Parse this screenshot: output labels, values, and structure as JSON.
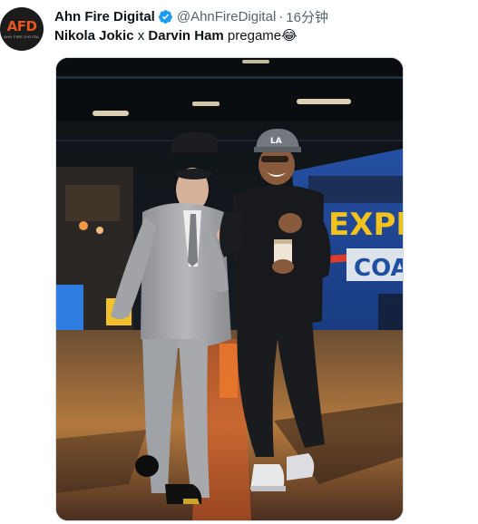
{
  "author": {
    "display_name": "Ahn Fire Digital",
    "handle": "@AhnFireDigital",
    "separator": "·",
    "timestamp": "16分钟",
    "avatar_text": "AFD",
    "avatar_subtext": "AHN FIRE DIGITAL",
    "verified": true
  },
  "tweet": {
    "name1": "Nikola Jokic",
    "connector": " x ",
    "name2": "Darvin Ham",
    "suffix": " pregame",
    "emoji": "😂"
  },
  "media": {
    "bus_text_1": "EXPR",
    "bus_text_2": "COA",
    "cap_logo": "LA",
    "colors": {
      "bus_blue": "#1f4fa0",
      "bus_yellow": "#f2c31c",
      "suit_gray": "#a6a8ab",
      "floor_warm": "#b3793e"
    }
  },
  "colors": {
    "text_primary": "#0f1419",
    "text_secondary": "#536471",
    "verified_blue": "#1d9bf0"
  }
}
